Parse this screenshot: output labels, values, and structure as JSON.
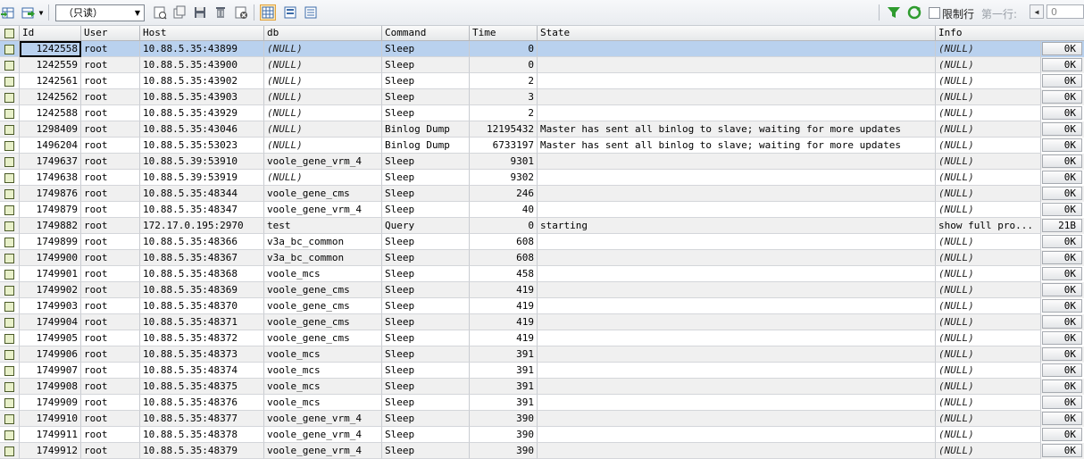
{
  "toolbar": {
    "mode_select": "（只读）",
    "limit_label": "限制行",
    "first_row_label": "第一行:",
    "first_row_value": "0"
  },
  "columns": [
    "Id",
    "User",
    "Host",
    "db",
    "Command",
    "Time",
    "State",
    "Info"
  ],
  "rows": [
    {
      "id": "1242558",
      "user": "root",
      "host": "10.88.5.35:43899",
      "db": "(NULL)",
      "cmd": "Sleep",
      "time": "0",
      "state": "",
      "info": "(NULL)",
      "size": "0K"
    },
    {
      "id": "1242559",
      "user": "root",
      "host": "10.88.5.35:43900",
      "db": "(NULL)",
      "cmd": "Sleep",
      "time": "0",
      "state": "",
      "info": "(NULL)",
      "size": "0K"
    },
    {
      "id": "1242561",
      "user": "root",
      "host": "10.88.5.35:43902",
      "db": "(NULL)",
      "cmd": "Sleep",
      "time": "2",
      "state": "",
      "info": "(NULL)",
      "size": "0K"
    },
    {
      "id": "1242562",
      "user": "root",
      "host": "10.88.5.35:43903",
      "db": "(NULL)",
      "cmd": "Sleep",
      "time": "3",
      "state": "",
      "info": "(NULL)",
      "size": "0K"
    },
    {
      "id": "1242588",
      "user": "root",
      "host": "10.88.5.35:43929",
      "db": "(NULL)",
      "cmd": "Sleep",
      "time": "2",
      "state": "",
      "info": "(NULL)",
      "size": "0K"
    },
    {
      "id": "1298409",
      "user": "root",
      "host": "10.88.5.35:43046",
      "db": "(NULL)",
      "cmd": "Binlog Dump",
      "time": "12195432",
      "state": "Master has sent all binlog to slave; waiting for more updates",
      "info": "(NULL)",
      "size": "0K"
    },
    {
      "id": "1496204",
      "user": "root",
      "host": "10.88.5.35:53023",
      "db": "(NULL)",
      "cmd": "Binlog Dump",
      "time": "6733197",
      "state": "Master has sent all binlog to slave; waiting for more updates",
      "info": "(NULL)",
      "size": "0K"
    },
    {
      "id": "1749637",
      "user": "root",
      "host": "10.88.5.39:53910",
      "db": "voole_gene_vrm_4",
      "cmd": "Sleep",
      "time": "9301",
      "state": "",
      "info": "(NULL)",
      "size": "0K"
    },
    {
      "id": "1749638",
      "user": "root",
      "host": "10.88.5.39:53919",
      "db": "(NULL)",
      "cmd": "Sleep",
      "time": "9302",
      "state": "",
      "info": "(NULL)",
      "size": "0K"
    },
    {
      "id": "1749876",
      "user": "root",
      "host": "10.88.5.35:48344",
      "db": "voole_gene_cms",
      "cmd": "Sleep",
      "time": "246",
      "state": "",
      "info": "(NULL)",
      "size": "0K"
    },
    {
      "id": "1749879",
      "user": "root",
      "host": "10.88.5.35:48347",
      "db": "voole_gene_vrm_4",
      "cmd": "Sleep",
      "time": "40",
      "state": "",
      "info": "(NULL)",
      "size": "0K"
    },
    {
      "id": "1749882",
      "user": "root",
      "host": "172.17.0.195:2970",
      "db": "test",
      "cmd": "Query",
      "time": "0",
      "state": "starting",
      "info": "show full pro...",
      "size": "21B"
    },
    {
      "id": "1749899",
      "user": "root",
      "host": "10.88.5.35:48366",
      "db": "v3a_bc_common",
      "cmd": "Sleep",
      "time": "608",
      "state": "",
      "info": "(NULL)",
      "size": "0K"
    },
    {
      "id": "1749900",
      "user": "root",
      "host": "10.88.5.35:48367",
      "db": "v3a_bc_common",
      "cmd": "Sleep",
      "time": "608",
      "state": "",
      "info": "(NULL)",
      "size": "0K"
    },
    {
      "id": "1749901",
      "user": "root",
      "host": "10.88.5.35:48368",
      "db": "voole_mcs",
      "cmd": "Sleep",
      "time": "458",
      "state": "",
      "info": "(NULL)",
      "size": "0K"
    },
    {
      "id": "1749902",
      "user": "root",
      "host": "10.88.5.35:48369",
      "db": "voole_gene_cms",
      "cmd": "Sleep",
      "time": "419",
      "state": "",
      "info": "(NULL)",
      "size": "0K"
    },
    {
      "id": "1749903",
      "user": "root",
      "host": "10.88.5.35:48370",
      "db": "voole_gene_cms",
      "cmd": "Sleep",
      "time": "419",
      "state": "",
      "info": "(NULL)",
      "size": "0K"
    },
    {
      "id": "1749904",
      "user": "root",
      "host": "10.88.5.35:48371",
      "db": "voole_gene_cms",
      "cmd": "Sleep",
      "time": "419",
      "state": "",
      "info": "(NULL)",
      "size": "0K"
    },
    {
      "id": "1749905",
      "user": "root",
      "host": "10.88.5.35:48372",
      "db": "voole_gene_cms",
      "cmd": "Sleep",
      "time": "419",
      "state": "",
      "info": "(NULL)",
      "size": "0K"
    },
    {
      "id": "1749906",
      "user": "root",
      "host": "10.88.5.35:48373",
      "db": "voole_mcs",
      "cmd": "Sleep",
      "time": "391",
      "state": "",
      "info": "(NULL)",
      "size": "0K"
    },
    {
      "id": "1749907",
      "user": "root",
      "host": "10.88.5.35:48374",
      "db": "voole_mcs",
      "cmd": "Sleep",
      "time": "391",
      "state": "",
      "info": "(NULL)",
      "size": "0K"
    },
    {
      "id": "1749908",
      "user": "root",
      "host": "10.88.5.35:48375",
      "db": "voole_mcs",
      "cmd": "Sleep",
      "time": "391",
      "state": "",
      "info": "(NULL)",
      "size": "0K"
    },
    {
      "id": "1749909",
      "user": "root",
      "host": "10.88.5.35:48376",
      "db": "voole_mcs",
      "cmd": "Sleep",
      "time": "391",
      "state": "",
      "info": "(NULL)",
      "size": "0K"
    },
    {
      "id": "1749910",
      "user": "root",
      "host": "10.88.5.35:48377",
      "db": "voole_gene_vrm_4",
      "cmd": "Sleep",
      "time": "390",
      "state": "",
      "info": "(NULL)",
      "size": "0K"
    },
    {
      "id": "1749911",
      "user": "root",
      "host": "10.88.5.35:48378",
      "db": "voole_gene_vrm_4",
      "cmd": "Sleep",
      "time": "390",
      "state": "",
      "info": "(NULL)",
      "size": "0K"
    },
    {
      "id": "1749912",
      "user": "root",
      "host": "10.88.5.35:48379",
      "db": "voole_gene_vrm_4",
      "cmd": "Sleep",
      "time": "390",
      "state": "",
      "info": "(NULL)",
      "size": "0K"
    }
  ],
  "colors": {
    "selected_row": "#b9d1ee",
    "alt_row": "#f0f0f0",
    "filter_green": "#2e9b2e"
  }
}
